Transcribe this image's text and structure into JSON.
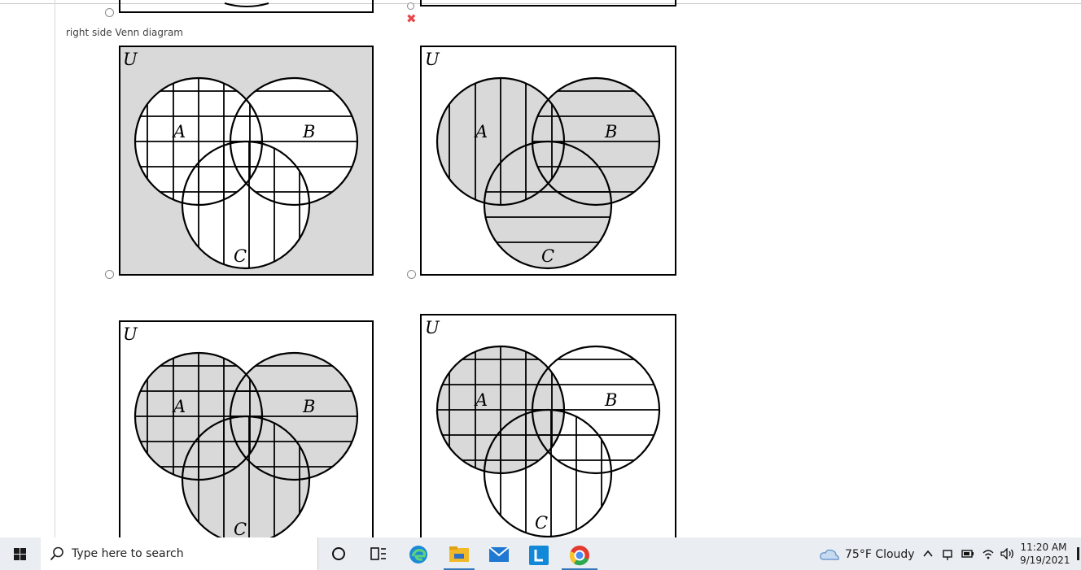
{
  "question": {
    "caption": "right side Venn diagram",
    "wrong_mark": "✖",
    "options": [
      {
        "id": "opt-1",
        "universe_label": "U",
        "labels": {
          "A": "A",
          "B": "B",
          "C": "C"
        }
      },
      {
        "id": "opt-2",
        "universe_label": "U",
        "labels": {
          "A": "A",
          "B": "B",
          "C": "C"
        }
      },
      {
        "id": "opt-3",
        "universe_label": "U",
        "labels": {
          "A": "A",
          "B": "B",
          "C": "C"
        }
      },
      {
        "id": "opt-4",
        "universe_label": "U",
        "labels": {
          "A": "A",
          "B": "B",
          "C": "C"
        }
      }
    ]
  },
  "taskbar": {
    "search_placeholder": "Type here to search",
    "weather": "75°F  Cloudy",
    "time": "11:20 AM",
    "date": "9/19/2021",
    "apps": [
      "cortana-icon",
      "task-view-icon",
      "edge-icon",
      "file-explorer-icon",
      "mail-icon",
      "l-app-icon",
      "chrome-icon"
    ],
    "colors": {
      "edge": "#1b8ad6",
      "explorer": "#f2b927",
      "mail": "#1f78d1",
      "l_app": "#1289d8",
      "chrome": "#e33b2e",
      "accent": "#3277bc"
    }
  }
}
